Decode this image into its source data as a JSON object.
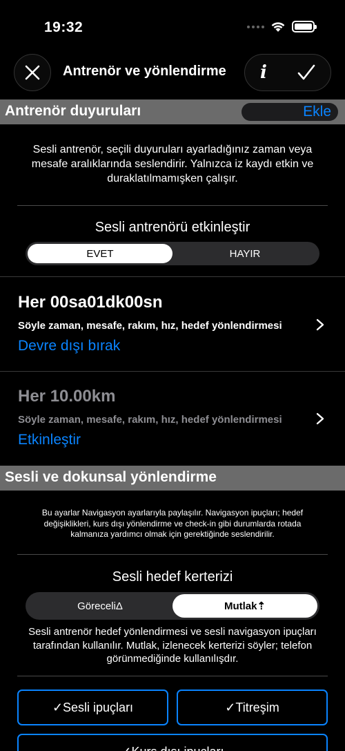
{
  "status": {
    "time": "19:32"
  },
  "nav": {
    "title": "Antrenör ve yönlendirme"
  },
  "coach_section": {
    "title": "Antrenör duyuruları",
    "add_label": "Ekle",
    "description": "Sesli antrenör, seçili duyuruları ayarladığınız zaman veya mesafe aralıklarında seslendirir. Yalnızca iz kaydı etkin ve duraklatılmamışken çalışır.",
    "enable_label": "Sesli antrenörü etkinleştir",
    "enable_options": [
      "EVET",
      "HAYIR"
    ],
    "enable_selected": "EVET",
    "announcements": [
      {
        "title": "Her 00sa01dk00sn",
        "subtitle": "Söyle zaman, mesafe, rakım, hız, hedef yönlendirmesi",
        "action": "Devre dışı bırak",
        "enabled": true
      },
      {
        "title": "Her 10.00km",
        "subtitle": "Söyle zaman, mesafe, rakım, hız, hedef yönlendirmesi",
        "action": "Etkinleştir",
        "enabled": false
      }
    ]
  },
  "guidance_section": {
    "title": "Sesli ve dokunsal yönlendirme",
    "description": "Bu ayarlar Navigasyon ayarlarıyla paylaşılır. Navigasyon ipuçları; hedef değişiklikleri, kurs dışı yönlendirme ve check-in gibi durumlarda rotada kalmanıza yardımcı olmak için gerektiğinde seslendirilir.",
    "bearing_label": "Sesli hedef kerterizi",
    "bearing_options": [
      "GöreceliΔ",
      "Mutlak⇡"
    ],
    "bearing_selected": "Mutlak⇡",
    "bearing_description": "Sesli antrenör hedef yönlendirmesi ve sesli navigasyon ipuçları tarafından kullanılır. Mutlak, izlenecek kerterizi söyler; telefon görünmediğinde kullanılışdır.",
    "toggles": [
      "✓Sesli ipuçları",
      "✓Titreşim",
      "✓Kurs dışı ipuçları"
    ]
  },
  "colors": {
    "accent": "#0a84ff",
    "section_header": "#6b6b6b",
    "background": "#000000"
  }
}
